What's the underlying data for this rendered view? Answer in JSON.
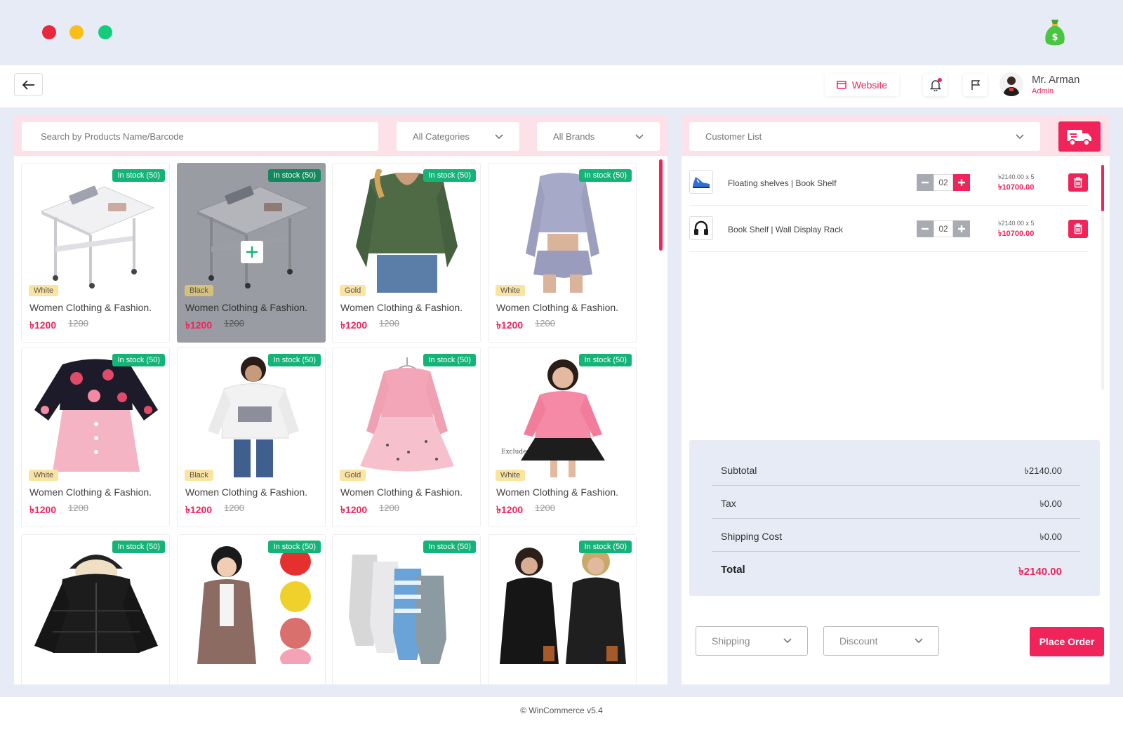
{
  "window": {
    "dots": [
      "#e8293d",
      "#f9bf16",
      "#14cc7c"
    ],
    "brand_icon": "money-bag-icon"
  },
  "header": {
    "back_icon": "arrow-left-icon",
    "website_label": "Website",
    "user": {
      "name": "Mr. Arman",
      "role": "Admin"
    }
  },
  "filters": {
    "search_placeholder": "Search by Products Name/Barcode",
    "categories": "All Categories",
    "brands": "All Brands"
  },
  "products": [
    {
      "stock": "In stock (50)",
      "color": "White",
      "name": "Women Clothing & Fashion.",
      "price": "৳1200",
      "old_price": "1200",
      "image": "desk"
    },
    {
      "stock": "In stock (50)",
      "color": "Black",
      "name": "Women Clothing & Fashion.",
      "price": "৳1200",
      "old_price": "1200",
      "image": "desk",
      "selected": true
    },
    {
      "stock": "In stock (50)",
      "color": "Gold",
      "name": "Women Clothing & Fashion.",
      "price": "৳1200",
      "old_price": "1200",
      "image": "green-hoodie"
    },
    {
      "stock": "In stock (50)",
      "color": "White",
      "name": "Women Clothing & Fashion.",
      "price": "৳1200",
      "old_price": "1200",
      "image": "lilac-set"
    },
    {
      "stock": "In stock (50)",
      "color": "White",
      "name": "Women Clothing & Fashion.",
      "price": "৳1200",
      "old_price": "1200",
      "image": "floral-dress"
    },
    {
      "stock": "In stock (50)",
      "color": "Black",
      "name": "Women Clothing & Fashion.",
      "price": "৳1200",
      "old_price": "1200",
      "image": "white-sweater"
    },
    {
      "stock": "In stock (50)",
      "color": "Gold",
      "name": "Women Clothing & Fashion.",
      "price": "৳1200",
      "old_price": "1200",
      "image": "pink-tutu"
    },
    {
      "stock": "In stock (50)",
      "color": "White",
      "name": "Women Clothing & Fashion.",
      "price": "৳1200",
      "old_price": "1200",
      "image": "girl-pink",
      "image_text": "Exclude"
    },
    {
      "stock": "In stock (50)",
      "image": "black-jacket"
    },
    {
      "stock": "In stock (50)",
      "image": "kid-coats"
    },
    {
      "stock": "In stock (50)",
      "image": "rompers"
    },
    {
      "stock": "In stock (50)",
      "image": "black-hoodies"
    }
  ],
  "customer": {
    "placeholder": "Customer List",
    "delivery_icon": "truck-icon"
  },
  "cart": [
    {
      "name": "Floating shelves | Book Shelf",
      "qty": "02",
      "unit": "৳2140.00 x 5",
      "total": "৳10700.00",
      "thumb": "sneaker-icon"
    },
    {
      "name": "Book Shelf | Wall Display Rack",
      "qty": "02",
      "unit": "৳2140.00 x 5",
      "total": "৳10700.00",
      "thumb": "headphones-icon"
    }
  ],
  "summary": {
    "subtotal_label": "Subtotal",
    "subtotal": "৳2140.00",
    "tax_label": "Tax",
    "tax": "৳0.00",
    "shipping_label": "Shipping Cost",
    "shipping": "৳0.00",
    "total_label": "Total",
    "total": "৳2140.00"
  },
  "actions": {
    "shipping": "Shipping",
    "discount": "Discount",
    "place_order": "Place Order"
  },
  "footer": "© WinCommerce v5.4",
  "colors": {
    "accent": "#f0245a",
    "stock_green": "#14b478",
    "panel_bg": "#e7ebf5",
    "filter_bar": "#fde1e8"
  }
}
